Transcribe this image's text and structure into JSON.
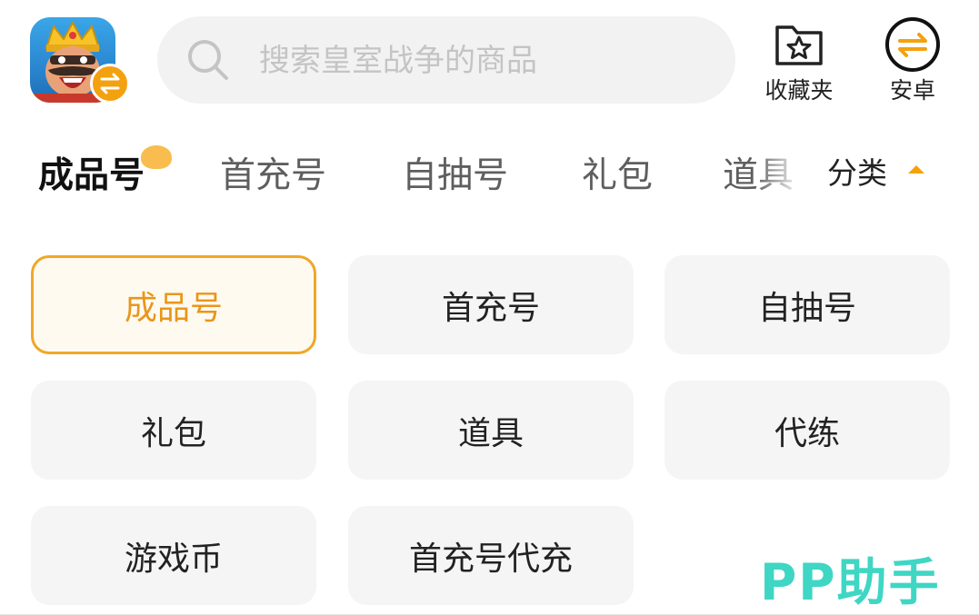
{
  "header": {
    "search_placeholder": "搜索皇室战争的商品",
    "favorites_label": "收藏夹",
    "platform_label": "安卓"
  },
  "tabs": [
    {
      "label": "成品号",
      "active": true
    },
    {
      "label": "首充号",
      "active": false
    },
    {
      "label": "自抽号",
      "active": false
    },
    {
      "label": "礼包",
      "active": false
    },
    {
      "label": "道具",
      "active": false
    }
  ],
  "category_button": {
    "label": "分类",
    "icon": "caret-up-icon"
  },
  "categories": [
    {
      "label": "成品号",
      "selected": true
    },
    {
      "label": "首充号",
      "selected": false
    },
    {
      "label": "自抽号",
      "selected": false
    },
    {
      "label": "礼包",
      "selected": false
    },
    {
      "label": "道具",
      "selected": false
    },
    {
      "label": "代练",
      "selected": false
    },
    {
      "label": "游戏币",
      "selected": false
    },
    {
      "label": "首充号代充",
      "selected": false
    }
  ],
  "watermark": "PP助手",
  "colors": {
    "accent": "#f0a727",
    "watermark": "#3fd6c4"
  }
}
